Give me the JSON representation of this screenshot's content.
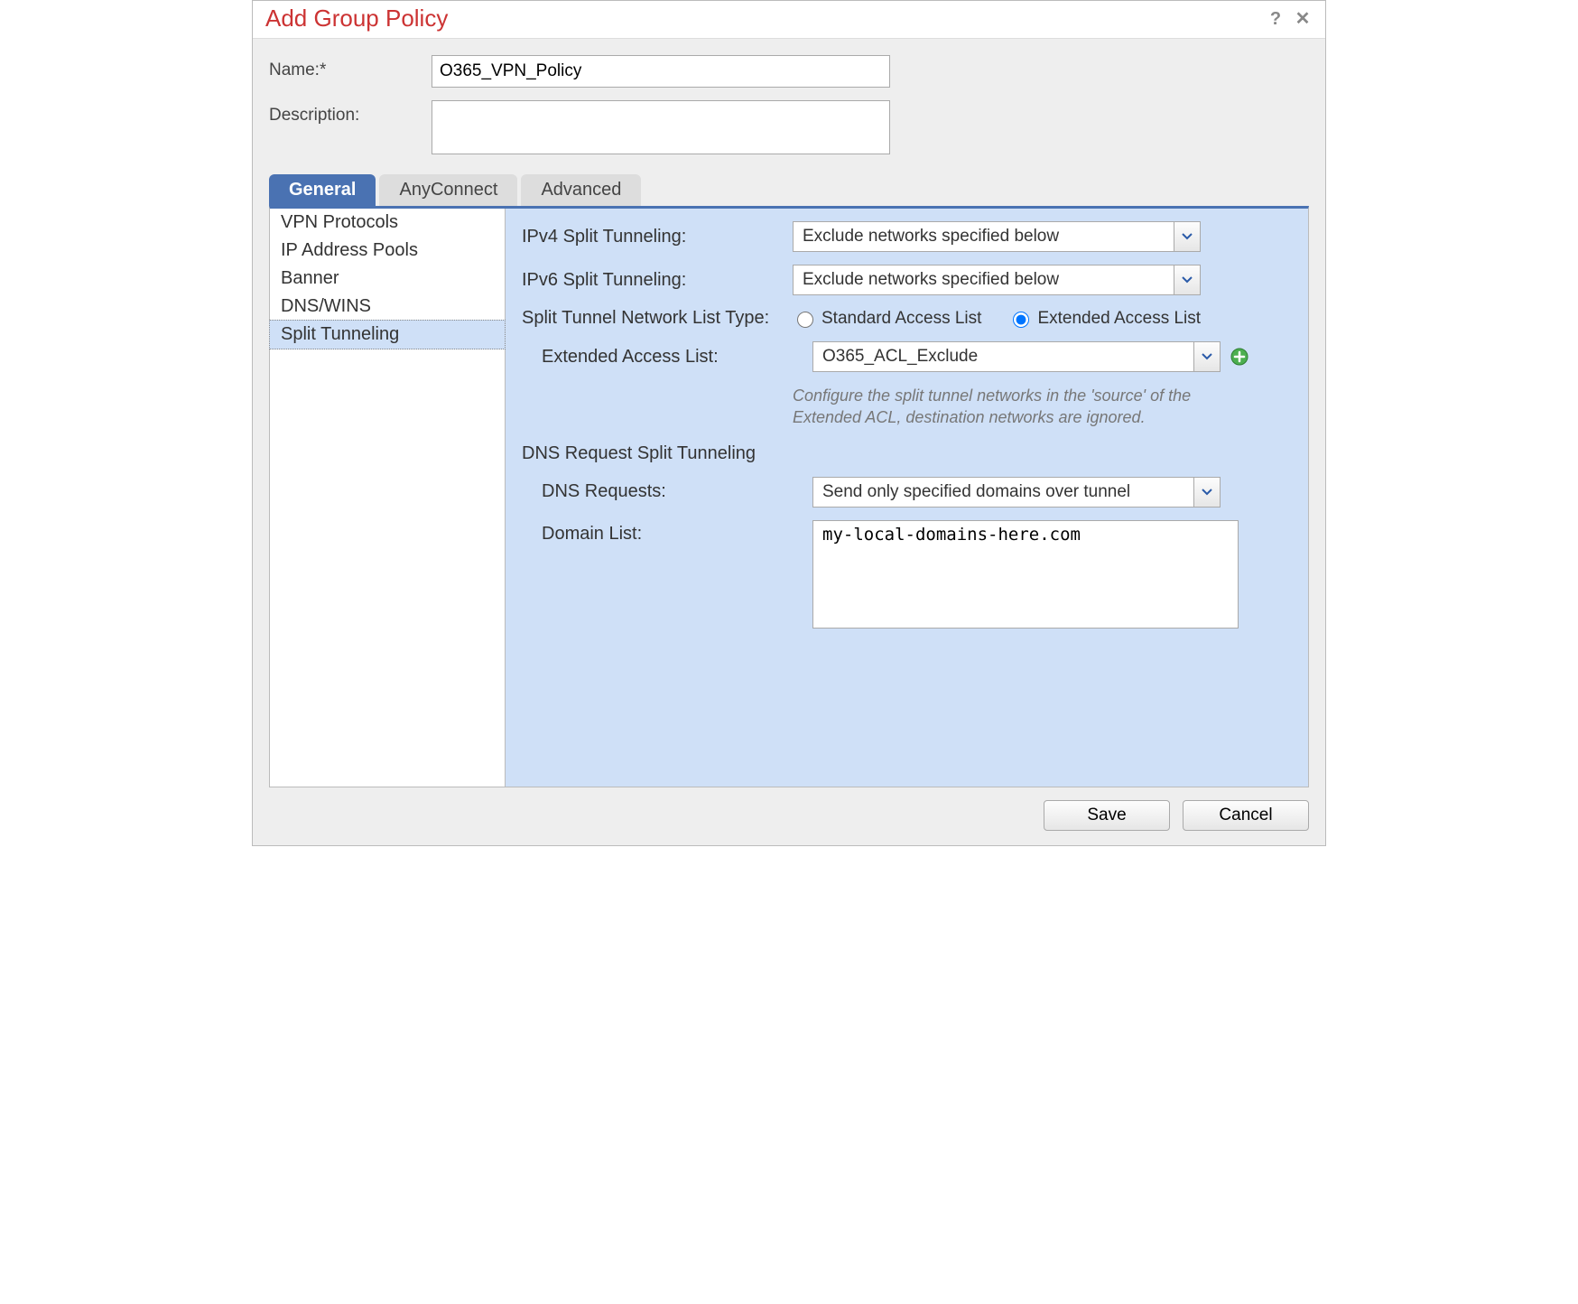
{
  "dialog": {
    "title": "Add Group Policy"
  },
  "fields": {
    "name_label": "Name:*",
    "name_value": "O365_VPN_Policy",
    "desc_label": "Description:",
    "desc_value": ""
  },
  "tabs": {
    "general": "General",
    "anyconnect": "AnyConnect",
    "advanced": "Advanced"
  },
  "sidebar": {
    "items": [
      {
        "label": "VPN Protocols",
        "selected": false
      },
      {
        "label": "IP Address Pools",
        "selected": false
      },
      {
        "label": "Banner",
        "selected": false
      },
      {
        "label": "DNS/WINS",
        "selected": false
      },
      {
        "label": "Split Tunneling",
        "selected": true
      }
    ]
  },
  "split": {
    "ipv4_label": "IPv4 Split Tunneling:",
    "ipv4_value": "Exclude networks specified below",
    "ipv6_label": "IPv6 Split Tunneling:",
    "ipv6_value": "Exclude networks specified below",
    "list_type_label": "Split Tunnel Network List Type:",
    "radio_standard": "Standard Access List",
    "radio_extended": "Extended Access List",
    "list_type_value": "extended",
    "ext_acl_label": "Extended Access List:",
    "ext_acl_value": "O365_ACL_Exclude",
    "helper_text": "Configure the split tunnel networks in the 'source' of the Extended ACL, destination networks are ignored.",
    "dns_section": "DNS Request Split Tunneling",
    "dns_req_label": "DNS Requests:",
    "dns_req_value": "Send only specified domains over tunnel",
    "domain_label": "Domain List:",
    "domain_value": "my-local-domains-here.com"
  },
  "buttons": {
    "save": "Save",
    "cancel": "Cancel"
  }
}
